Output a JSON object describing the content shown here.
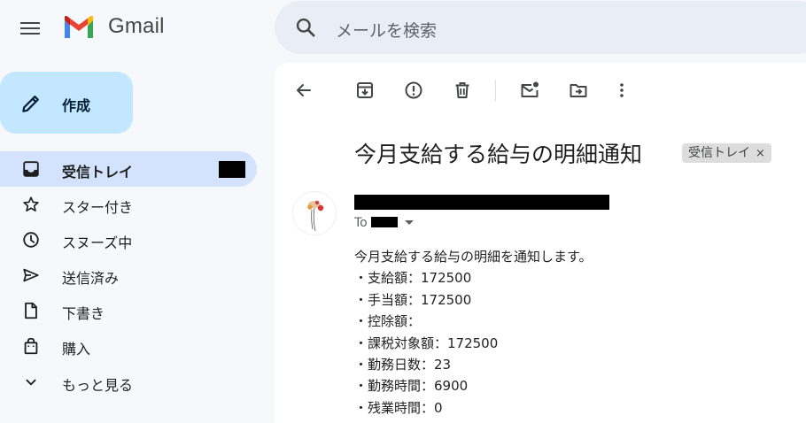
{
  "app": {
    "name": "Gmail"
  },
  "search": {
    "placeholder": "メールを検索"
  },
  "compose": {
    "label": "作成"
  },
  "sidebar": {
    "items": [
      {
        "label": "受信トレイ",
        "icon": "inbox-icon",
        "active": true
      },
      {
        "label": "スター付き",
        "icon": "star-icon"
      },
      {
        "label": "スヌーズ中",
        "icon": "clock-icon"
      },
      {
        "label": "送信済み",
        "icon": "send-icon"
      },
      {
        "label": "下書き",
        "icon": "draft-icon"
      },
      {
        "label": "購入",
        "icon": "shopping-bag-icon"
      },
      {
        "label": "もっと見る",
        "icon": "chevron-down-icon"
      }
    ]
  },
  "toolbar": {
    "icons": [
      "back-arrow-icon",
      "archive-icon",
      "report-spam-icon",
      "delete-icon",
      "mark-unread-icon",
      "move-to-icon",
      "more-vert-icon"
    ]
  },
  "email": {
    "subject": "今月支給する給与の明細通知",
    "label_chip": "受信トレイ",
    "label_close": "×",
    "to_prefix": "To",
    "body": [
      "今月支給する給与の明細を通知します。",
      "・支給額：172500",
      "・手当額：172500",
      "・控除額：",
      "・課税対象額：172500",
      "・勤務日数：23",
      "・勤務時間：6900",
      "・残業時間：0"
    ]
  },
  "colors": {
    "background": "#f6f8fc",
    "compose_bg": "#c2e7ff",
    "active_nav_bg": "#d3e3fd",
    "search_bg": "#e9eef6",
    "gmail_red": "#ea4335",
    "gmail_blue": "#4285f4",
    "gmail_green": "#34a853",
    "gmail_yellow": "#fbbc04"
  }
}
